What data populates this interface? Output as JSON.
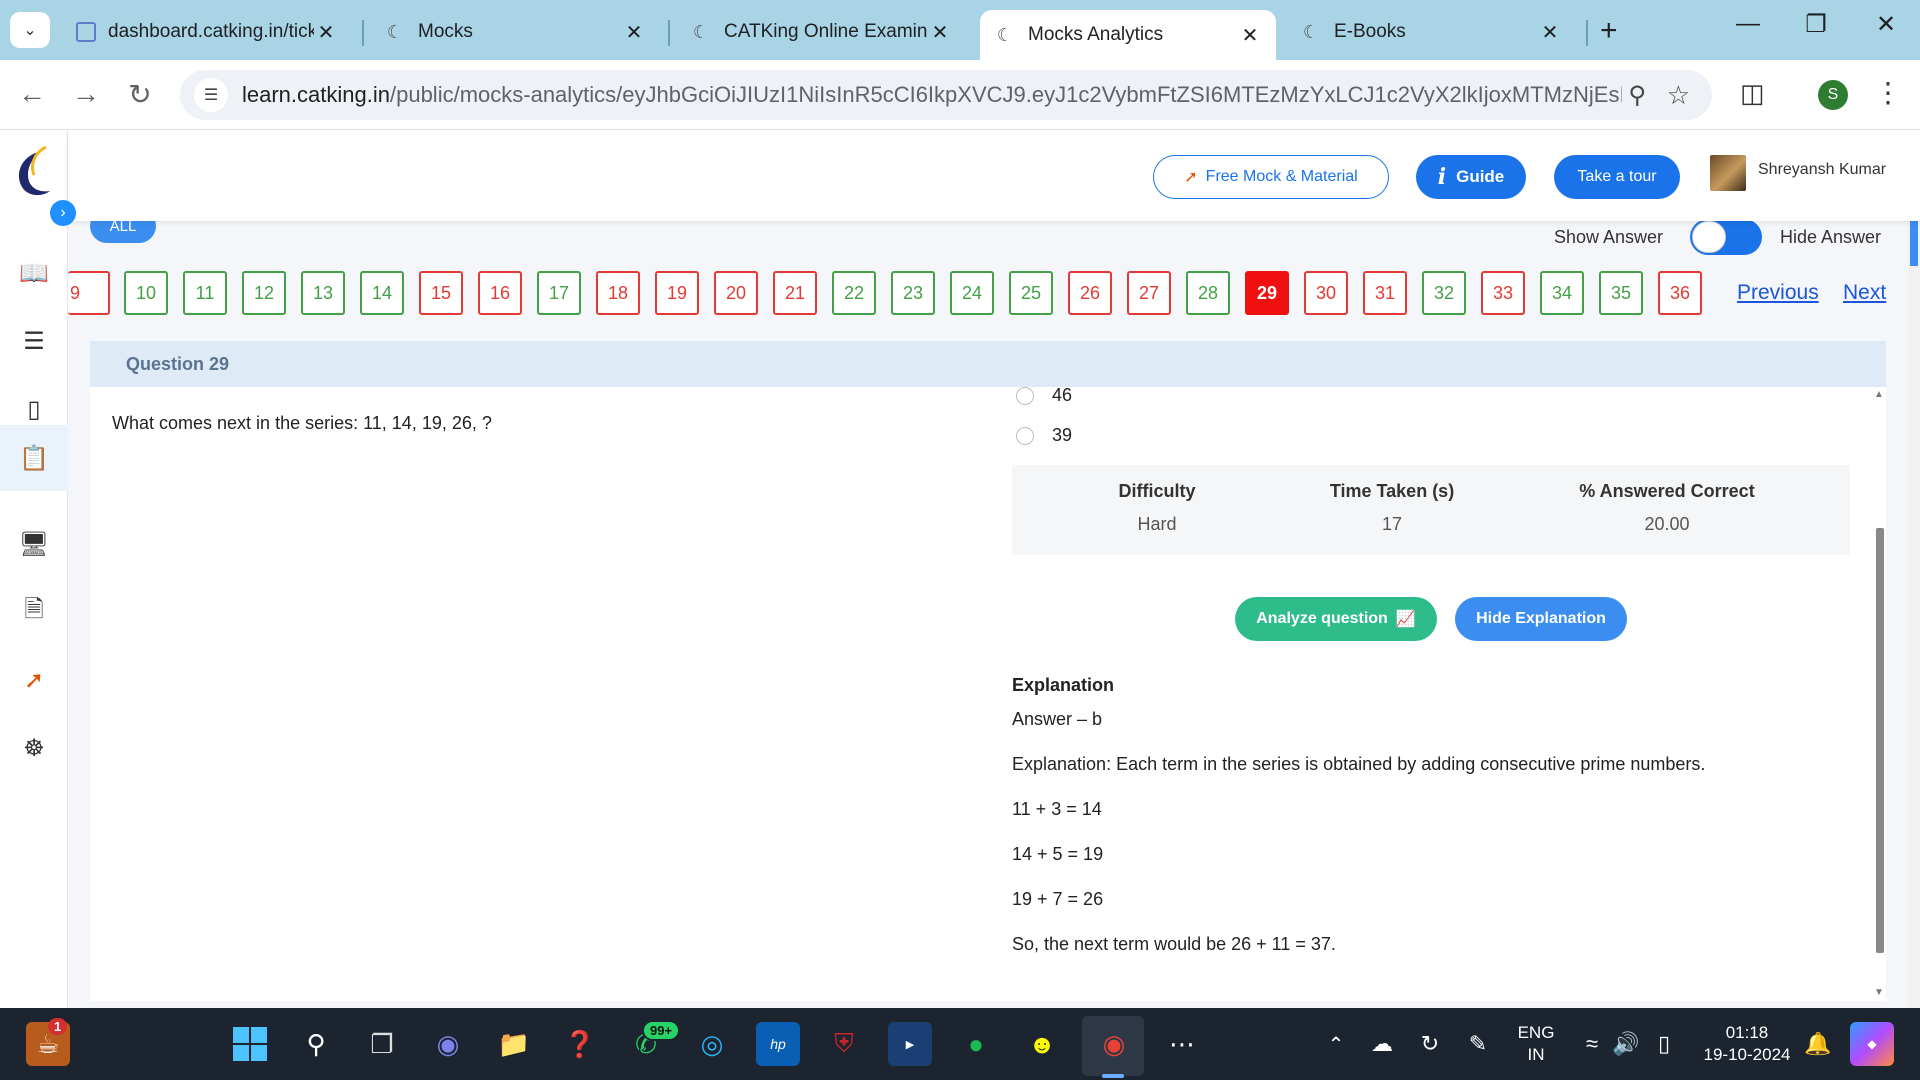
{
  "browser": {
    "tabs": [
      {
        "title": "dashboard.catking.in/tick",
        "favicon": "doc"
      },
      {
        "title": "Mocks",
        "favicon": "catking"
      },
      {
        "title": "CATKing Online Examinat",
        "favicon": "catking"
      },
      {
        "title": "Mocks Analytics",
        "favicon": "catking"
      },
      {
        "title": "E-Books",
        "favicon": "catking"
      }
    ],
    "url_host": "learn.catking.in",
    "url_path": "/public/mocks-analytics/eyJhbGciOiJIUzI1NiIsInR5cCI6IkpXVCJ9.eyJ1c2VybmFtZSI6MTEzMzYxLCJ1c2VyX2lkIjoxMTMzNjEsImluc3Rp...",
    "profile_initial": "S"
  },
  "header": {
    "free_mock": "Free Mock & Material",
    "guide": "Guide",
    "tour": "Take a tour",
    "username": "Shreyansh Kumar"
  },
  "filters": {
    "all": "ALL",
    "show_answer": "Show Answer",
    "hide_answer": "Hide Answer"
  },
  "question_nav": {
    "partial_first": "9",
    "items": [
      {
        "n": "10",
        "status": "correct"
      },
      {
        "n": "11",
        "status": "correct"
      },
      {
        "n": "12",
        "status": "correct"
      },
      {
        "n": "13",
        "status": "correct"
      },
      {
        "n": "14",
        "status": "correct"
      },
      {
        "n": "15",
        "status": "wrong"
      },
      {
        "n": "16",
        "status": "wrong"
      },
      {
        "n": "17",
        "status": "correct"
      },
      {
        "n": "18",
        "status": "wrong"
      },
      {
        "n": "19",
        "status": "wrong"
      },
      {
        "n": "20",
        "status": "wrong"
      },
      {
        "n": "21",
        "status": "wrong"
      },
      {
        "n": "22",
        "status": "correct"
      },
      {
        "n": "23",
        "status": "correct"
      },
      {
        "n": "24",
        "status": "correct"
      },
      {
        "n": "25",
        "status": "correct"
      },
      {
        "n": "26",
        "status": "wrong"
      },
      {
        "n": "27",
        "status": "wrong"
      },
      {
        "n": "28",
        "status": "correct"
      },
      {
        "n": "29",
        "status": "current"
      },
      {
        "n": "30",
        "status": "wrong"
      },
      {
        "n": "31",
        "status": "wrong"
      },
      {
        "n": "32",
        "status": "correct"
      },
      {
        "n": "33",
        "status": "wrong"
      },
      {
        "n": "34",
        "status": "correct"
      },
      {
        "n": "35",
        "status": "correct"
      },
      {
        "n": "36",
        "status": "wrong"
      }
    ],
    "previous": "Previous",
    "next": "Next"
  },
  "question": {
    "heading": "Question 29",
    "text": "What comes next in the series: 11, 14, 19, 26, ?",
    "options": [
      "46",
      "39"
    ]
  },
  "stats": {
    "difficulty_label": "Difficulty",
    "difficulty": "Hard",
    "time_label": "Time Taken (s)",
    "time": "17",
    "correct_label": "% Answered Correct",
    "correct": "20.00"
  },
  "actions": {
    "analyze": "Analyze question",
    "hide_explanation": "Hide Explanation"
  },
  "explanation": {
    "title": "Explanation",
    "answer": "Answer – b",
    "lines": [
      "Explanation: Each term in the series is obtained by adding consecutive prime numbers.",
      "11 + 3 = 14",
      "14 + 5 = 19",
      "19 + 7 = 26",
      "So, the next term would be 26 + 11 = 37."
    ]
  },
  "taskbar": {
    "notif_count": "1",
    "whatsapp_badge": "99+",
    "lang_top": "ENG",
    "lang_bottom": "IN",
    "time": "01:18",
    "date": "19-10-2024"
  },
  "colors": {
    "correct": "#43a047",
    "wrong": "#e53935",
    "current": "#f01010",
    "primary": "#1a73e8",
    "analyze": "#2ebd8a"
  }
}
